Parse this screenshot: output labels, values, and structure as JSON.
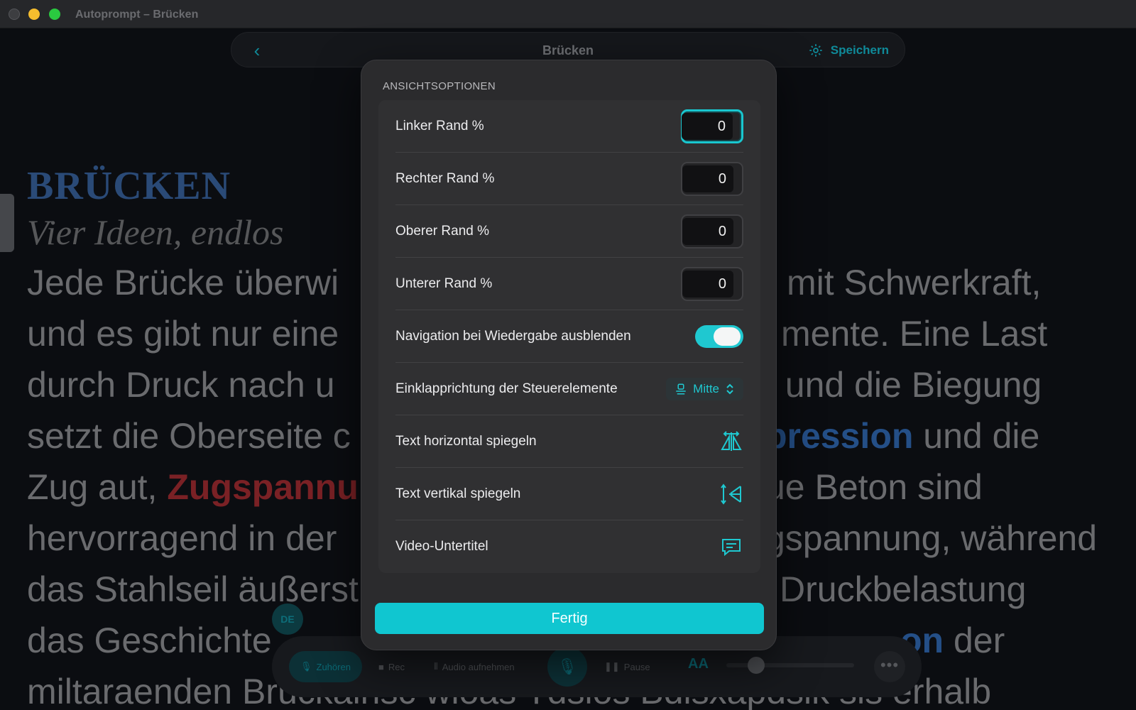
{
  "window": {
    "title": "Autoprompt – Brücken"
  },
  "topbar": {
    "back_icon": "chevron-left-icon",
    "title": "Brücken",
    "save_label": "Speichern",
    "save_icon": "gear-icon"
  },
  "document": {
    "heading": "BRÜCKEN",
    "subtitle": "Vier Ideen, endlos",
    "lines": [
      {
        "left": "Jede Brücke überwi",
        "right": "mit Schwerkraft,"
      },
      {
        "left": "und es gibt nur eine",
        "right": "mente. Eine Last"
      },
      {
        "left": "durch Druck nach u",
        "right": "t und die Biegung"
      },
      {
        "left": "setzt die Oberseite c",
        "right_hl": "pression",
        "right": " und die"
      },
      {
        "left": "Zug aut, ",
        "left_hl": "Zugspannu",
        "right": "ue Beton sind"
      },
      {
        "left": "hervorragend in der",
        "right": "gspannung, während"
      },
      {
        "left": "das Stahlseil äußerst",
        "right": "Druckbelastung"
      },
      {
        "left": "das Geschichte",
        "right_hl": "on",
        "right": " der"
      },
      {
        "left": "miltaraenden Brückalnsc wioas Tdslos Bdisxapdsik sls erhalb",
        "right": ""
      }
    ]
  },
  "language_badge": "DE",
  "bottom_bar": {
    "listen": "Zuhören",
    "rec": "Rec",
    "audio": "Audio aufnehmen",
    "pause": "Pause",
    "font_size": "AA",
    "more": "•••"
  },
  "modal": {
    "header": "ANSICHTSOPTIONEN",
    "rows": {
      "left_margin": {
        "label": "Linker Rand %",
        "value": "0"
      },
      "right_margin": {
        "label": "Rechter Rand %",
        "value": "0"
      },
      "top_margin": {
        "label": "Oberer Rand %",
        "value": "0"
      },
      "bottom_margin": {
        "label": "Unterer Rand %",
        "value": "0"
      },
      "hide_nav": {
        "label": "Navigation bei Wiedergabe ausblenden",
        "on": true
      },
      "collapse_dir": {
        "label": "Einklapprichtung der Steuerelemente",
        "value": "Mitte"
      },
      "mirror_h": {
        "label": "Text horizontal spiegeln",
        "icon": "flip-horizontal-icon"
      },
      "mirror_v": {
        "label": "Text vertikal spiegeln",
        "icon": "flip-vertical-icon"
      },
      "subtitles": {
        "label": "Video-Untertitel",
        "icon": "subtitles-icon"
      }
    },
    "done_label": "Fertig"
  },
  "colors": {
    "accent": "#1fc8d0",
    "modal_bg": "#2b2b2d",
    "heading_blue": "#2a4a77",
    "highlight_red": "#7a2125"
  }
}
